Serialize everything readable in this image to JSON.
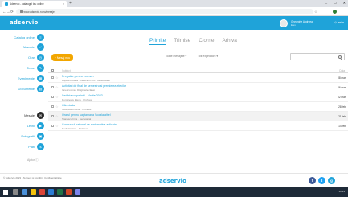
{
  "browser": {
    "tab_title": "Adservio - catalogul tau online",
    "tab_close": "×",
    "new_tab": "+",
    "url": "www.adservio.ro/ro/mesaje",
    "window_controls": [
      "–",
      "☐",
      "✕"
    ]
  },
  "header": {
    "logo": "adservio",
    "user_name": "Gheorghe Andreea",
    "user_role": "Elev",
    "logout": "⏻ Iesire"
  },
  "sidebar": {
    "items": [
      {
        "label": "Catalog online",
        "icon": "≡"
      },
      {
        "label": "Absente",
        "icon": "✓"
      },
      {
        "label": "Orar",
        "icon": "◷"
      },
      {
        "label": "Teme",
        "icon": "✎"
      },
      {
        "label": "Evenimente",
        "icon": "▦"
      },
      {
        "label": "Documente",
        "icon": "▤"
      },
      {
        "label": "Mesaje",
        "icon": "✉"
      },
      {
        "label": "Lectii",
        "icon": "▶"
      },
      {
        "label": "Fotografii",
        "icon": "▣"
      },
      {
        "label": "Plati",
        "icon": "$"
      }
    ],
    "active_index": 6,
    "footer": "Ajutor ⓘ"
  },
  "main": {
    "tabs": [
      "Primite",
      "Trimise",
      "Ciorne",
      "Arhiva"
    ],
    "active_tab": 0,
    "new_button": "+ Mesaj nou",
    "filters": [
      "Toate mesajele ▾",
      "Toti expeditorii ▾"
    ],
    "columns": {
      "subject": "Subiect",
      "date": "Data"
    },
    "rows": [
      {
        "subject": "Pregatire pentru examen",
        "preview": "Popescu Maria · clasa a XI-a B · Matematica",
        "date": "08 mar",
        "shaded": false
      },
      {
        "subject": "Activitati de final de semestru si premierea elevilor",
        "preview": "Ionescu Ana · Dirigintele clasei",
        "date": "06 mar",
        "shaded": false
      },
      {
        "subject": "Sedinta cu parintii - Martie 2023",
        "preview": "Dumitrescu Elena · Profesor",
        "date": "02 mar",
        "shaded": false
      },
      {
        "subject": "Olimpiada",
        "preview": "Georgescu Mihai · Profesor",
        "date": "28 feb",
        "shaded": false
      },
      {
        "subject": "Orarul pentru saptamana Scoala altfel",
        "preview": "Stanescu Irina · Secretariat",
        "date": "21 feb",
        "shaded": true
      },
      {
        "subject": "Concursul national de matematica aplicata",
        "preview": "Radu Cristina · Profesor",
        "date": "14 feb",
        "shaded": false
      }
    ]
  },
  "footer": {
    "copyright": "© Adservio 2023 · Termeni si conditii · Confidentialitate",
    "logo": "adservio",
    "social": [
      {
        "icon": "f",
        "color": "#3b5998"
      },
      {
        "icon": "t",
        "color": "#1da1f2"
      },
      {
        "icon": "g",
        "color": "#1fa3d9"
      }
    ]
  },
  "taskbar": {
    "time": "10:24"
  }
}
